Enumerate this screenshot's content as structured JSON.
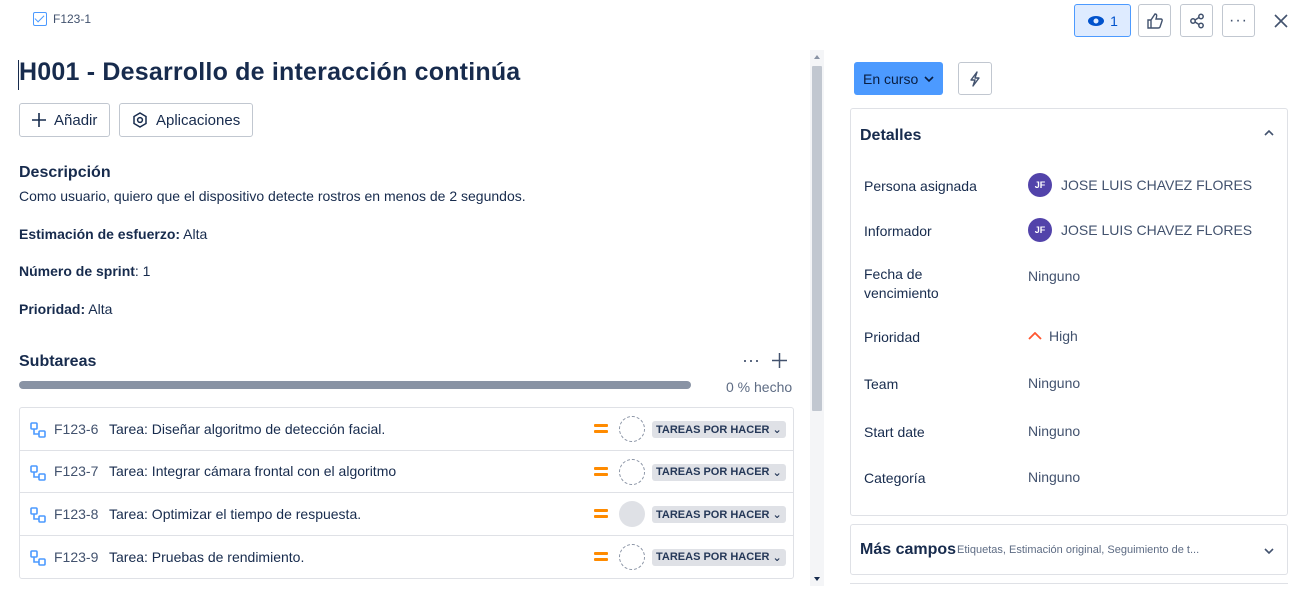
{
  "breadcrumb": {
    "issue_key": "F123-1"
  },
  "toolbar": {
    "watch_count": "1"
  },
  "issue": {
    "title": "H001 - Desarrollo de interacción continúa",
    "add_label": "Añadir",
    "apps_label": "Aplicaciones",
    "description_heading": "Descripción",
    "description_text": "Como usuario, quiero que el dispositivo detecte rostros en menos de 2 segundos.",
    "effort_label": "Estimación de esfuerzo:",
    "effort_value": " Alta",
    "sprint_label": "Número de sprint",
    "sprint_value": ": 1",
    "priority_label": "Prioridad:",
    "priority_value": " Alta"
  },
  "subtasks": {
    "heading": "Subtareas",
    "progress_percent": 0,
    "progress_text": "0 % hecho",
    "items": [
      {
        "key": "F123-6",
        "summary": "Tarea: Diseñar algoritmo de detección facial.",
        "status": "TAREAS POR HACER",
        "assignee": "none"
      },
      {
        "key": "F123-7",
        "summary": "Tarea: Integrar cámara frontal con el algoritmo",
        "status": "TAREAS POR HACER",
        "assignee": "none"
      },
      {
        "key": "F123-8",
        "summary": "Tarea: Optimizar el tiempo de respuesta.",
        "status": "TAREAS POR HACER",
        "assignee": "grey"
      },
      {
        "key": "F123-9",
        "summary": "Tarea: Pruebas de rendimiento.",
        "status": "TAREAS POR HACER",
        "assignee": "none"
      }
    ]
  },
  "sidebar": {
    "status_label": "En curso",
    "details_heading": "Detalles",
    "fields": [
      {
        "label": "Persona asignada",
        "value": "JOSE LUIS CHAVEZ FLORES",
        "avatar": "JF"
      },
      {
        "label": "Informador",
        "value": "JOSE LUIS CHAVEZ FLORES",
        "avatar": "JF"
      },
      {
        "label": "Fecha de vencimiento",
        "value": "Ninguno"
      },
      {
        "label": "Prioridad",
        "value": "High"
      },
      {
        "label": "Team",
        "value": "Ninguno"
      },
      {
        "label": "Start date",
        "value": "Ninguno"
      },
      {
        "label": "Categoría",
        "value": "Ninguno"
      }
    ],
    "more_fields_title": "Más campos",
    "more_fields_sub": "Etiquetas, Estimación original, Seguimiento de t..."
  },
  "colors": {
    "accent": "#4c9aff",
    "avatar": "#5243aa",
    "priority_high": "#ff5630",
    "priority_medium": "#ff8b00"
  }
}
